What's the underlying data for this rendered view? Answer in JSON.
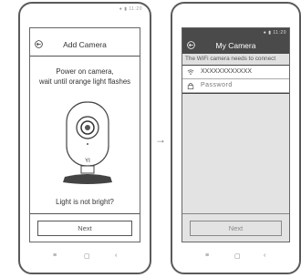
{
  "left_screen": {
    "status_text": "● ▮ 11:20",
    "title": "Add Camera",
    "instruction_line1": "Power on camera,",
    "instruction_line2": "wait until orange light flashes",
    "camera_brand": "YI",
    "help_link": "Light is not bright?",
    "next_label": "Next"
  },
  "right_screen": {
    "status_text": "● ▮ 11:20",
    "title": "My Camera",
    "notice": "The WiFi camera needs to connect",
    "ssid_value": "XXXXXXXXXXXX",
    "password_placeholder": "Password",
    "next_label": "Next"
  },
  "navbar": {
    "menu": "≡",
    "home": "▢",
    "back": "‹"
  },
  "arrow": "→"
}
